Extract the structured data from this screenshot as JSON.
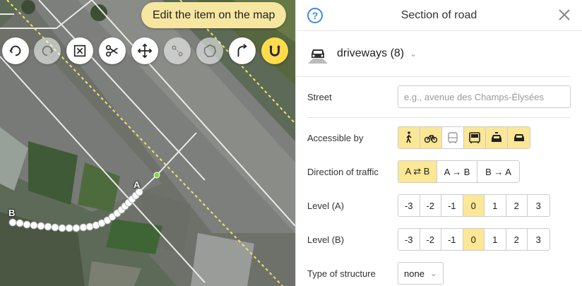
{
  "map": {
    "hint": "Edit the item on the map",
    "point_a": "A",
    "point_b": "B",
    "tools": [
      {
        "name": "undo",
        "state": "normal"
      },
      {
        "name": "redo",
        "state": "disabled"
      },
      {
        "name": "delete",
        "state": "normal"
      },
      {
        "name": "split",
        "state": "normal"
      },
      {
        "name": "move",
        "state": "normal"
      },
      {
        "name": "draw-line",
        "state": "disabled"
      },
      {
        "name": "circle",
        "state": "disabled"
      },
      {
        "name": "curve",
        "state": "normal"
      },
      {
        "name": "magnet",
        "state": "active"
      }
    ]
  },
  "panel": {
    "title": "Section of road",
    "help": "?",
    "road_type": "driveways (8)",
    "street_label": "Street",
    "street_placeholder": "e.g., avenue des Champs-Élysées",
    "accessible_label": "Accessible by",
    "accessible": [
      {
        "icon": "pedestrian-icon",
        "on": true
      },
      {
        "icon": "bicycle-icon",
        "on": true
      },
      {
        "icon": "bus-icon",
        "on": false
      },
      {
        "icon": "truck-icon",
        "on": true
      },
      {
        "icon": "taxi-icon",
        "on": true
      },
      {
        "icon": "car-icon",
        "on": true
      }
    ],
    "direction_label": "Direction of traffic",
    "direction": [
      "A ⇄ B",
      "A → B",
      "B → A"
    ],
    "direction_selected": 0,
    "level_a_label": "Level (A)",
    "level_b_label": "Level (B)",
    "levels": [
      "-3",
      "-2",
      "-1",
      "0",
      "1",
      "2",
      "3"
    ],
    "level_a_selected": 3,
    "level_b_selected": 3,
    "structure_label": "Type of structure",
    "structure_value": "none"
  },
  "colors": {
    "accent": "#ffdb4d",
    "toggle_on": "#fbe796",
    "help_blue": "#3c8bdf"
  }
}
